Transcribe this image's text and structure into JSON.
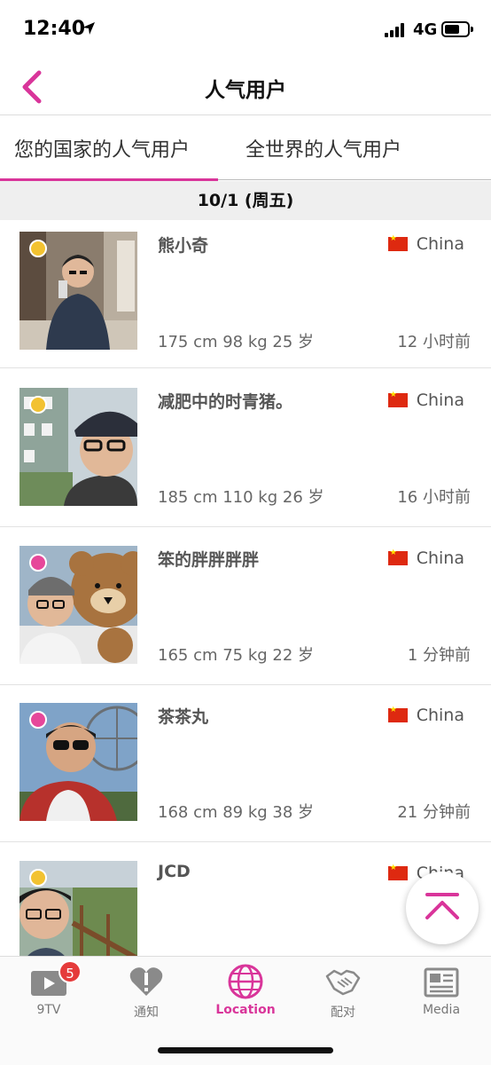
{
  "status_bar": {
    "time": "12:40",
    "network": "4G"
  },
  "nav": {
    "title": "人气用户"
  },
  "tabs": [
    {
      "label": "您的国家的人气用户",
      "active": true
    },
    {
      "label": "全世界的人气用户",
      "active": false
    }
  ],
  "date_header": "10/1 (周五)",
  "users": [
    {
      "name": "熊小奇",
      "country": "China",
      "stats": "175 cm 98 kg 25 岁",
      "time": "12 小时前",
      "status_color": "#f2c231"
    },
    {
      "name": "减肥中的时青猪。",
      "country": "China",
      "stats": "185 cm 110 kg 26 岁",
      "time": "16 小时前",
      "status_color": "#f2c231"
    },
    {
      "name": "笨的胖胖胖胖",
      "country": "China",
      "stats": "165 cm 75 kg 22 岁",
      "time": "1 分钟前",
      "status_color": "#e6479a"
    },
    {
      "name": "茶茶丸",
      "country": "China",
      "stats": "168 cm 89 kg 38 岁",
      "time": "21 分钟前",
      "status_color": "#e6479a"
    },
    {
      "name": "JCD",
      "country": "China",
      "stats": "",
      "time": "",
      "status_color": "#f2c231"
    }
  ],
  "tab_bar": {
    "items": [
      {
        "label": "9TV",
        "icon": "play-icon",
        "badge": "5"
      },
      {
        "label": "通知",
        "icon": "heart-alert-icon"
      },
      {
        "label": "Location",
        "icon": "globe-icon",
        "active": true
      },
      {
        "label": "配对",
        "icon": "handshake-icon"
      },
      {
        "label": "Media",
        "icon": "newspaper-icon"
      }
    ]
  },
  "colors": {
    "accent": "#d9359a",
    "status_yellow": "#f2c231",
    "status_pink": "#e6479a"
  }
}
